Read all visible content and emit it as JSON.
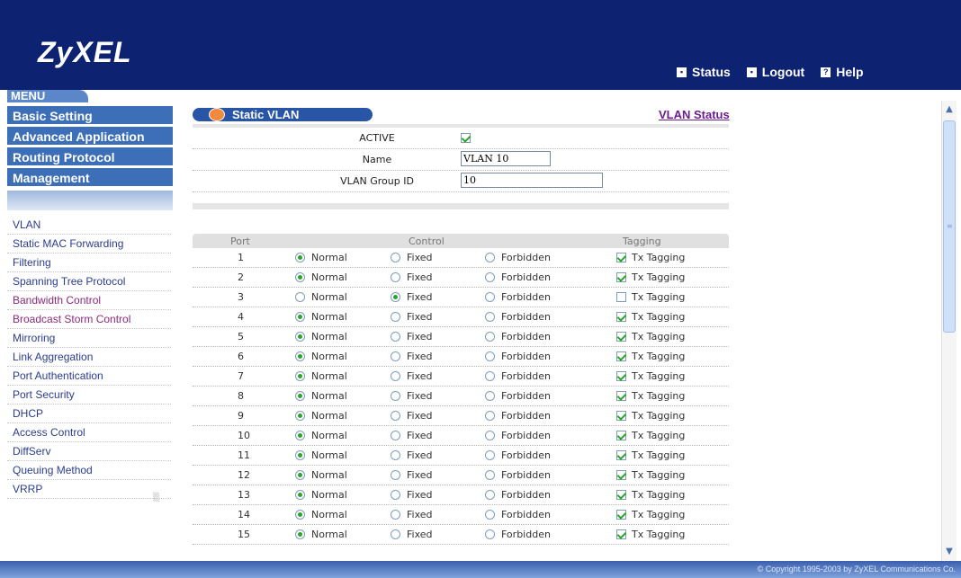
{
  "brand": {
    "logo": "ZyXEL"
  },
  "top_links": [
    {
      "label": "Status",
      "icon": "status-icon"
    },
    {
      "label": "Logout",
      "icon": "logout-icon"
    },
    {
      "label": "Help",
      "icon": "help-icon"
    }
  ],
  "menu": {
    "tab": "MENU",
    "sections": [
      "Basic Setting",
      "Advanced Application",
      "Routing Protocol",
      "Management"
    ],
    "items": [
      "VLAN",
      "Static MAC Forwarding",
      "Filtering",
      "Spanning Tree Protocol",
      "Bandwidth Control",
      "Broadcast Storm Control",
      "Mirroring",
      "Link Aggregation",
      "Port Authentication",
      "Port Security",
      "DHCP",
      "Access Control",
      "DiffServ",
      "Queuing Method",
      "VRRP"
    ]
  },
  "page": {
    "title": "Static VLAN",
    "status_link": "VLAN Status"
  },
  "form": {
    "active_label": "ACTIVE",
    "name_label": "Name",
    "name_value": "VLAN 10",
    "group_label": "VLAN Group ID",
    "group_value": "10"
  },
  "table": {
    "headers": {
      "port": "Port",
      "control": "Control",
      "tagging": "Tagging"
    },
    "option_labels": {
      "normal": "Normal",
      "fixed": "Fixed",
      "forbidden": "Forbidden",
      "tx": "Tx Tagging"
    },
    "rows": [
      {
        "port": "1",
        "control": "normal",
        "tagging": true
      },
      {
        "port": "2",
        "control": "normal",
        "tagging": true
      },
      {
        "port": "3",
        "control": "fixed",
        "tagging": false
      },
      {
        "port": "4",
        "control": "normal",
        "tagging": true
      },
      {
        "port": "5",
        "control": "normal",
        "tagging": true
      },
      {
        "port": "6",
        "control": "normal",
        "tagging": true
      },
      {
        "port": "7",
        "control": "normal",
        "tagging": true
      },
      {
        "port": "8",
        "control": "normal",
        "tagging": true
      },
      {
        "port": "9",
        "control": "normal",
        "tagging": true
      },
      {
        "port": "10",
        "control": "normal",
        "tagging": true
      },
      {
        "port": "11",
        "control": "normal",
        "tagging": true
      },
      {
        "port": "12",
        "control": "normal",
        "tagging": true
      },
      {
        "port": "13",
        "control": "normal",
        "tagging": true
      },
      {
        "port": "14",
        "control": "normal",
        "tagging": true
      },
      {
        "port": "15",
        "control": "normal",
        "tagging": true
      }
    ]
  },
  "footer": {
    "copyright": "© Copyright 1995-2003 by ZyXEL Communications Co."
  },
  "colors": {
    "header": "#0d2270",
    "menu": "#3d6fb8",
    "accent": "#2855a6",
    "check": "#2aa52a"
  }
}
